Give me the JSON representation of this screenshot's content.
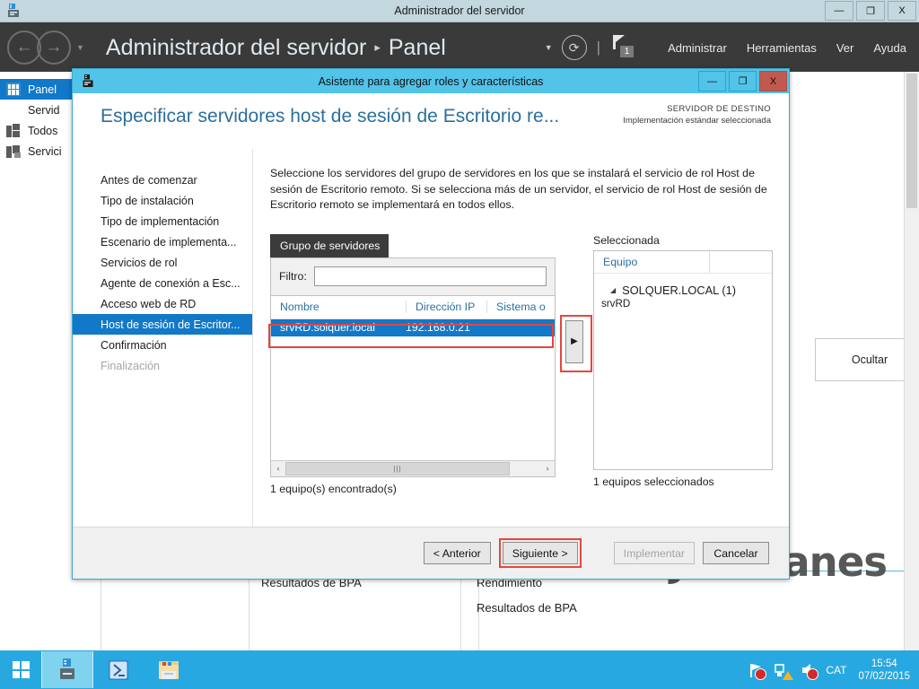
{
  "window": {
    "title": "Administrador del servidor",
    "icon": "server-manager-icon",
    "controls": {
      "minimize": "—",
      "maximize": "❐",
      "close": "X"
    }
  },
  "server_manager": {
    "breadcrumb_root": "Administrador del servidor",
    "breadcrumb_sep": "▸",
    "breadcrumb_page": "Panel",
    "notification_count": "1",
    "menus": [
      "Administrar",
      "Herramientas",
      "Ver",
      "Ayuda"
    ],
    "sidebar": [
      {
        "label": "Panel",
        "icon": "dashboard-grid-icon",
        "active": true
      },
      {
        "label": "Servid",
        "icon": "local-server-icon",
        "active": false
      },
      {
        "label": "Todos",
        "icon": "all-servers-icon",
        "active": false
      },
      {
        "label": "Servici",
        "icon": "file-services-icon",
        "active": false
      }
    ],
    "background_labels": [
      "Resultados de BPA",
      "Rendimiento",
      "Resultados de BPA"
    ],
    "hide_button": "Ocultar",
    "watermark": "JVSolanes"
  },
  "wizard": {
    "title": "Asistente para agregar roles y características",
    "icon": "wizard-server-icon",
    "controls": {
      "minimize": "—",
      "maximize": "❐",
      "close": "X"
    },
    "heading": "Especificar servidores host de sesión de Escritorio re...",
    "destination": {
      "line1": "SERVIDOR DE DESTINO",
      "line2": "Implementación estándar seleccionada"
    },
    "nav": [
      {
        "label": "Antes de comenzar",
        "state": "normal"
      },
      {
        "label": "Tipo de instalación",
        "state": "normal"
      },
      {
        "label": "Tipo de implementación",
        "state": "normal"
      },
      {
        "label": "Escenario de implementa...",
        "state": "normal"
      },
      {
        "label": "Servicios de rol",
        "state": "normal"
      },
      {
        "label": "Agente de conexión a Esc...",
        "state": "normal"
      },
      {
        "label": "Acceso web de RD",
        "state": "normal"
      },
      {
        "label": "Host de sesión de Escritor...",
        "state": "selected"
      },
      {
        "label": "Confirmación",
        "state": "normal"
      },
      {
        "label": "Finalización",
        "state": "disabled"
      }
    ],
    "intro": "Seleccione los servidores del grupo de servidores en los que se instalará el servicio de rol Host de sesión de Escritorio remoto. Si se selecciona más de un servidor, el servicio de rol Host de sesión de Escritorio remoto se implementará en todos ellos.",
    "pool": {
      "tab_label": "Grupo de servidores",
      "filter_label": "Filtro:",
      "filter_value": "",
      "filter_placeholder": "",
      "columns": [
        "Nombre",
        "Dirección IP",
        "Sistema o"
      ],
      "rows": [
        {
          "name": "srvRD.solquer.local",
          "ip": "192.168.0.21",
          "os": ""
        }
      ],
      "footer": "1 equipo(s) encontrado(s)",
      "scroll_thumb_glyph": "|||",
      "scroll_left": "‹",
      "scroll_right": "›"
    },
    "transfer_button": {
      "label": "▶",
      "name": "add-selected-server-button"
    },
    "selected": {
      "label": "Seleccionada",
      "column": "Equipo",
      "group": "SOLQUER.LOCAL (1)",
      "group_toggle": "◢",
      "items": [
        "srvRD"
      ],
      "footer": "1 equipos seleccionados"
    },
    "buttons": {
      "previous": "< Anterior",
      "next": "Siguiente >",
      "deploy": "Implementar",
      "cancel": "Cancelar"
    }
  },
  "taskbar": {
    "start_tooltip": "Inicio",
    "apps": [
      {
        "name": "server-manager-taskbar-icon",
        "active": true
      },
      {
        "name": "powershell-taskbar-icon",
        "active": false
      },
      {
        "name": "file-explorer-taskbar-icon",
        "active": false
      }
    ],
    "tray": {
      "language": "CAT",
      "time": "15:54",
      "date": "07/02/2015"
    }
  },
  "colors": {
    "accent_blue": "#1278c8",
    "wizard_cyan": "#52c3e9",
    "highlight_red": "#e8453c",
    "taskbar_blue": "#28a8e0",
    "header_dark": "#3a3a3a"
  }
}
